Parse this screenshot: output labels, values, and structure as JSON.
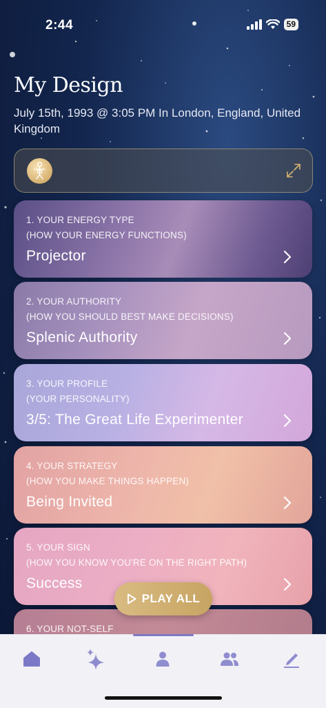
{
  "status_bar": {
    "time": "2:44",
    "battery": "59"
  },
  "header": {
    "title": "My Design",
    "subtitle": "July 15th, 1993 @ 3:05 PM In London, England, United Kingdom"
  },
  "chart_box": {
    "avatar_icon": "body-chart-icon",
    "expand_icon": "expand-arrows-icon"
  },
  "cards": [
    {
      "label_line1": "1. YOUR ENERGY TYPE",
      "label_line2": "(HOW YOUR ENERGY FUNCTIONS)",
      "value": "Projector"
    },
    {
      "label_line1": "2. YOUR AUTHORITY",
      "label_line2": "(HOW YOU SHOULD BEST MAKE DECISIONS)",
      "value": "Splenic Authority"
    },
    {
      "label_line1": "3. YOUR PROFILE",
      "label_line2": "(YOUR PERSONALITY)",
      "value": "3/5: The Great Life Experimenter"
    },
    {
      "label_line1": "4. YOUR STRATEGY",
      "label_line2": "(HOW YOU MAKE THINGS HAPPEN)",
      "value": "Being Invited"
    },
    {
      "label_line1": "5. YOUR SIGN",
      "label_line2": "(HOW YOU KNOW YOU'RE ON THE RIGHT PATH)",
      "value": "Success"
    },
    {
      "label_line1": "6. YOUR NOT-SELF"
    }
  ],
  "play_all": {
    "label": "PLAY ALL",
    "icon": "play-icon"
  },
  "tab_bar": {
    "tabs": [
      {
        "icon": "home-icon",
        "active": true
      },
      {
        "icon": "sparkle-icon"
      },
      {
        "icon": "person-icon"
      },
      {
        "icon": "people-icon"
      },
      {
        "icon": "pencil-icon"
      }
    ],
    "accent": "#7b79c7"
  }
}
